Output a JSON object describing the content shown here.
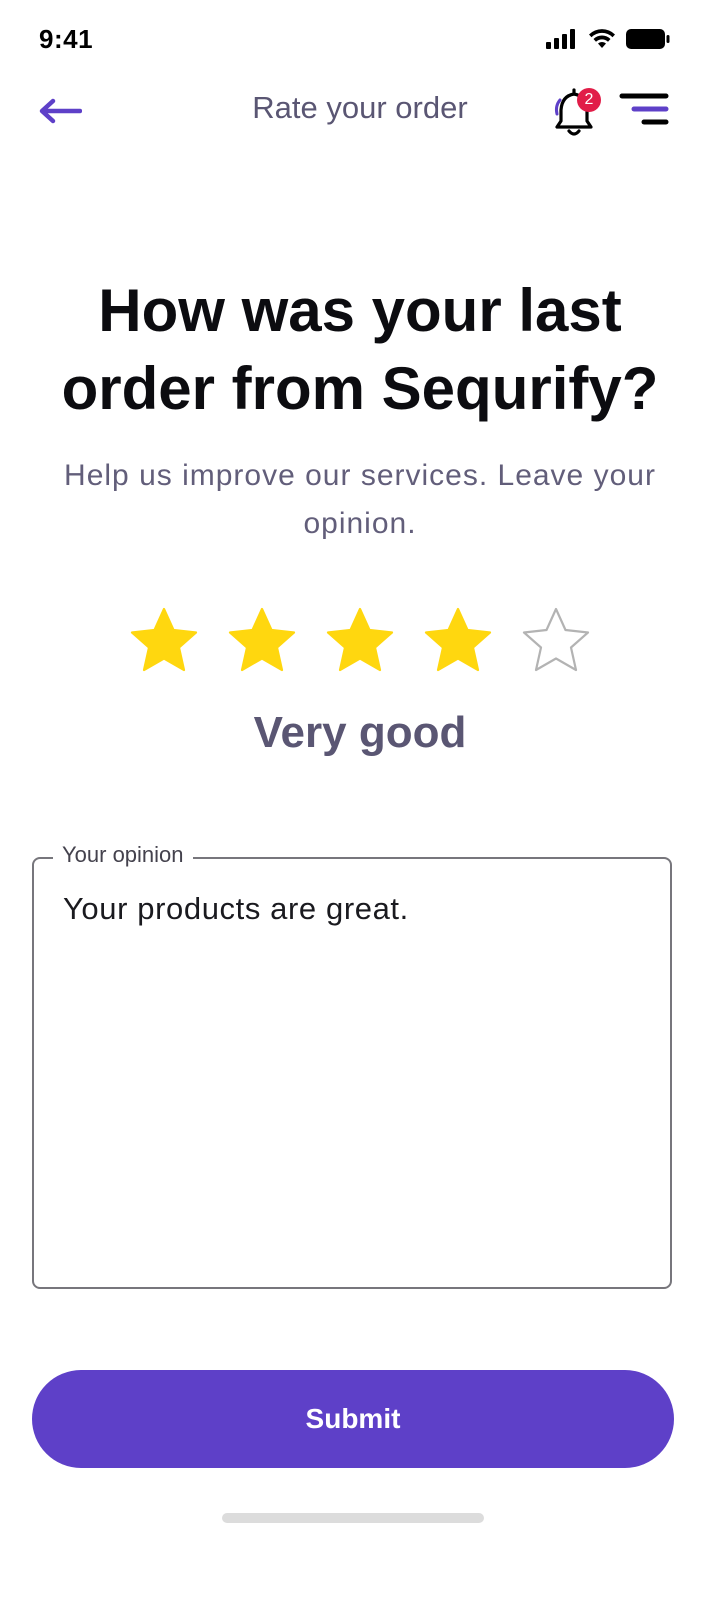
{
  "status_bar": {
    "time": "9:41",
    "icons": [
      "signal-icon",
      "wifi-icon",
      "battery-icon"
    ]
  },
  "header": {
    "title": "Rate your order",
    "notification_count": "2",
    "icons": [
      "arrow-left-icon",
      "bell-icon",
      "menu-icon"
    ]
  },
  "main": {
    "question": "How was your last order from Sequrify?",
    "subtitle": "Help us improve our services. Leave your opinion.",
    "rating": {
      "value": 4,
      "max": 5,
      "label": "Very good"
    },
    "opinion": {
      "label": "Your opinion",
      "value": "Your products are great."
    },
    "submit_label": "Submit"
  },
  "colors": {
    "accent": "#5e40c8",
    "star_filled": "#ffd70f",
    "star_empty": "#b3b3b3",
    "badge": "#e11d48",
    "text_muted": "#5a5673"
  }
}
